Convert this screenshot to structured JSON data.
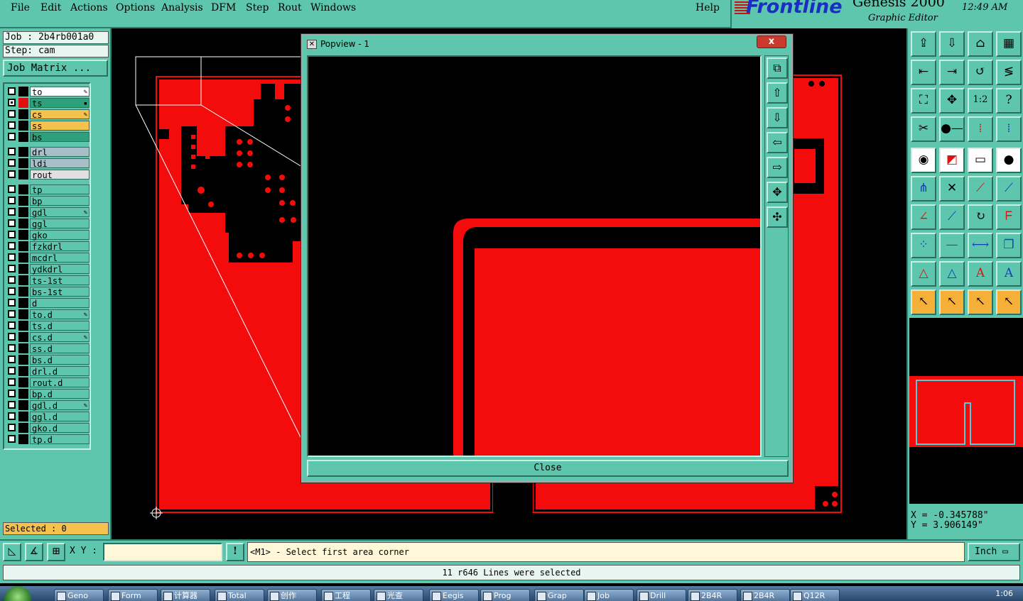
{
  "menu": {
    "items": [
      "File",
      "Edit",
      "Actions",
      "Options",
      "Analysis",
      "DFM",
      "Step",
      "Rout",
      "Windows"
    ],
    "help": "Help"
  },
  "brand": {
    "logo": "Frontline",
    "product": "Genesis 2000",
    "subtitle": "Graphic Editor",
    "time": "12:49 AM"
  },
  "job": {
    "job_label": "Job : 2b4rb001a0",
    "step_label": "Step: cam",
    "matrix_button": "Job Matrix ..."
  },
  "layers": [
    {
      "name": "to",
      "color": "#ffffff",
      "swatch": "#000000",
      "checked": false,
      "mark": "pen"
    },
    {
      "name": "ts",
      "color": "#2ea07a",
      "swatch": "#e01010",
      "checked": true,
      "mark": "dot"
    },
    {
      "name": "cs",
      "color": "#f6c24e",
      "swatch": "#000000",
      "checked": false,
      "mark": "pen"
    },
    {
      "name": "ss",
      "color": "#f6c24e",
      "swatch": "#000000",
      "checked": false,
      "mark": ""
    },
    {
      "name": "bs",
      "color": "#2ea07a",
      "swatch": "#000000",
      "checked": false,
      "mark": ""
    },
    {
      "name": "drl",
      "color": "#a6bfc8",
      "swatch": "#000000",
      "checked": false,
      "mark": ""
    },
    {
      "name": "ldi",
      "color": "#a6bfc8",
      "swatch": "#000000",
      "checked": false,
      "mark": ""
    },
    {
      "name": "rout",
      "color": "#e0e0e0",
      "swatch": "#000000",
      "checked": false,
      "mark": ""
    },
    {
      "name": "tp",
      "color": "#5dc6ad",
      "swatch": "#000000",
      "checked": false,
      "mark": ""
    },
    {
      "name": "bp",
      "color": "#5dc6ad",
      "swatch": "#000000",
      "checked": false,
      "mark": ""
    },
    {
      "name": "gdl",
      "color": "#5dc6ad",
      "swatch": "#000000",
      "checked": false,
      "mark": "pen"
    },
    {
      "name": "ggl",
      "color": "#5dc6ad",
      "swatch": "#000000",
      "checked": false,
      "mark": ""
    },
    {
      "name": "gko",
      "color": "#5dc6ad",
      "swatch": "#000000",
      "checked": false,
      "mark": ""
    },
    {
      "name": "fzkdrl",
      "color": "#5dc6ad",
      "swatch": "#000000",
      "checked": false,
      "mark": ""
    },
    {
      "name": "mcdrl",
      "color": "#5dc6ad",
      "swatch": "#000000",
      "checked": false,
      "mark": ""
    },
    {
      "name": "ydkdrl",
      "color": "#5dc6ad",
      "swatch": "#000000",
      "checked": false,
      "mark": ""
    },
    {
      "name": "ts-1st",
      "color": "#5dc6ad",
      "swatch": "#000000",
      "checked": false,
      "mark": ""
    },
    {
      "name": "bs-1st",
      "color": "#5dc6ad",
      "swatch": "#000000",
      "checked": false,
      "mark": ""
    },
    {
      "name": "d",
      "color": "#5dc6ad",
      "swatch": "#000000",
      "checked": false,
      "mark": ""
    },
    {
      "name": "to.d",
      "color": "#5dc6ad",
      "swatch": "#000000",
      "checked": false,
      "mark": "pen"
    },
    {
      "name": "ts.d",
      "color": "#5dc6ad",
      "swatch": "#000000",
      "checked": false,
      "mark": ""
    },
    {
      "name": "cs.d",
      "color": "#5dc6ad",
      "swatch": "#000000",
      "checked": false,
      "mark": "pen"
    },
    {
      "name": "ss.d",
      "color": "#5dc6ad",
      "swatch": "#000000",
      "checked": false,
      "mark": ""
    },
    {
      "name": "bs.d",
      "color": "#5dc6ad",
      "swatch": "#000000",
      "checked": false,
      "mark": ""
    },
    {
      "name": "drl.d",
      "color": "#5dc6ad",
      "swatch": "#000000",
      "checked": false,
      "mark": ""
    },
    {
      "name": "rout.d",
      "color": "#5dc6ad",
      "swatch": "#000000",
      "checked": false,
      "mark": ""
    },
    {
      "name": "bp.d",
      "color": "#5dc6ad",
      "swatch": "#000000",
      "checked": false,
      "mark": ""
    },
    {
      "name": "gdl.d",
      "color": "#5dc6ad",
      "swatch": "#000000",
      "checked": false,
      "mark": "pen"
    },
    {
      "name": "ggl.d",
      "color": "#5dc6ad",
      "swatch": "#000000",
      "checked": false,
      "mark": ""
    },
    {
      "name": "gko.d",
      "color": "#5dc6ad",
      "swatch": "#000000",
      "checked": false,
      "mark": ""
    },
    {
      "name": "tp.d",
      "color": "#5dc6ad",
      "swatch": "#000000",
      "checked": false,
      "mark": ""
    }
  ],
  "selected_label": "Selected : 0",
  "popview": {
    "title": "Popview - 1",
    "close_x": "x",
    "close_button": "Close"
  },
  "coords": {
    "x": "X = -0.345788\"",
    "y": "Y = 3.906149\""
  },
  "command": {
    "xy_label": "X Y :",
    "xy_value": "",
    "excl": "!",
    "message": "<M1> - Select first area corner",
    "unit": "Inch"
  },
  "status": "11 r646 Lines were selected",
  "taskbar": {
    "tasks": [
      "Geno",
      "Form",
      "计算器",
      "Total",
      "创作",
      "工程",
      "光查",
      "Eegis",
      "Prog",
      "Grap",
      "Job",
      "Drill",
      "2B4R",
      "2B4R",
      "Q12R"
    ],
    "clock": "1:06"
  },
  "colors": {
    "panel": "#5dc6ad",
    "copper": "#f40c0c",
    "highlight": "#f6c24e"
  }
}
